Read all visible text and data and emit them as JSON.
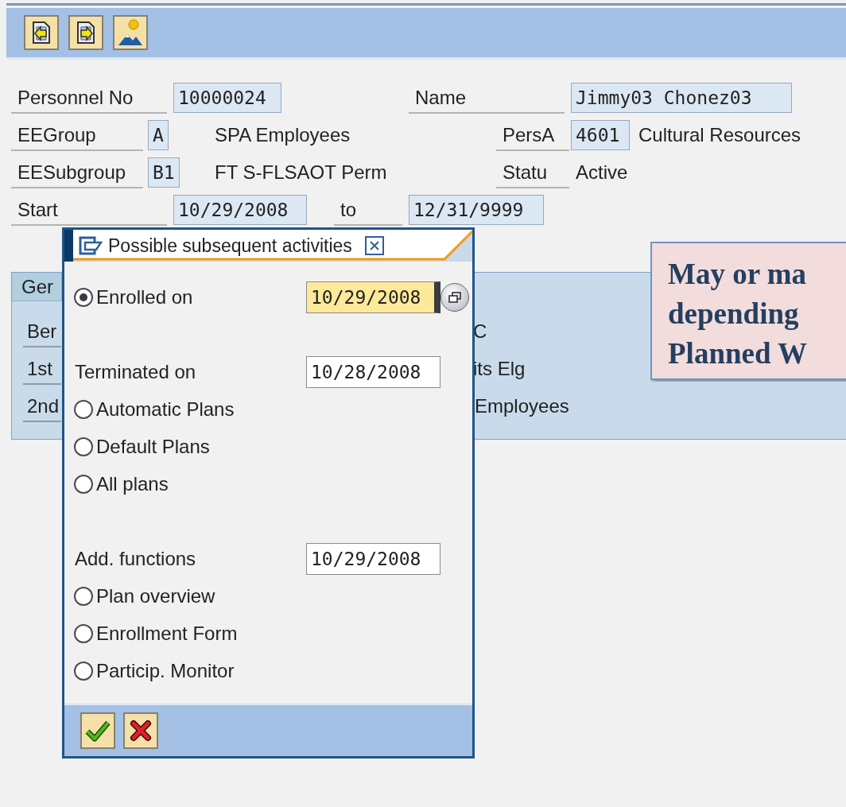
{
  "header": {
    "rows": [
      [
        {
          "label": "Personnel No",
          "value": "10000024"
        },
        {
          "label": "Name",
          "value": "Jimmy03 Chonez03"
        }
      ],
      [
        {
          "label": "EEGroup",
          "value": "A",
          "text": "SPA Employees"
        },
        {
          "label": "PersA",
          "value": "4601",
          "text": "Cultural Resources"
        }
      ],
      [
        {
          "label": "EESubgroup",
          "value": "B1",
          "text": "FT S-FLSAOT Perm"
        },
        {
          "label": "Statu",
          "text": "Active"
        }
      ],
      [
        {
          "label": "Start",
          "value": "10/29/2008"
        },
        {
          "label": "to",
          "value": "12/31/9999"
        }
      ]
    ]
  },
  "panel": {
    "tab": "Ger",
    "rows": [
      {
        "label": "Ber",
        "value": "C"
      },
      {
        "label": "1st",
        "value": "its Elg"
      },
      {
        "label": "2nd",
        "value": "Employees"
      }
    ]
  },
  "dialog": {
    "title": "Possible subsequent activities",
    "items": [
      {
        "kind": "radio",
        "label": "Enrolled on",
        "selected": true,
        "date": "10/29/2008",
        "focused": true
      },
      {
        "kind": "heading",
        "label": "Terminated on",
        "date": "10/28/2008",
        "focused": false
      },
      {
        "kind": "radio",
        "label": "Automatic Plans",
        "selected": false
      },
      {
        "kind": "radio",
        "label": "Default Plans",
        "selected": false
      },
      {
        "kind": "radio",
        "label": "All plans",
        "selected": false
      },
      {
        "kind": "heading",
        "label": "Add. functions",
        "date": "10/29/2008",
        "focused": false
      },
      {
        "kind": "radio",
        "label": "Plan overview",
        "selected": false
      },
      {
        "kind": "radio",
        "label": "Enrollment Form",
        "selected": false
      },
      {
        "kind": "radio",
        "label": "Particip. Monitor",
        "selected": false
      }
    ]
  },
  "callout": {
    "lines": [
      "May or ma",
      "depending",
      "Planned W"
    ]
  }
}
